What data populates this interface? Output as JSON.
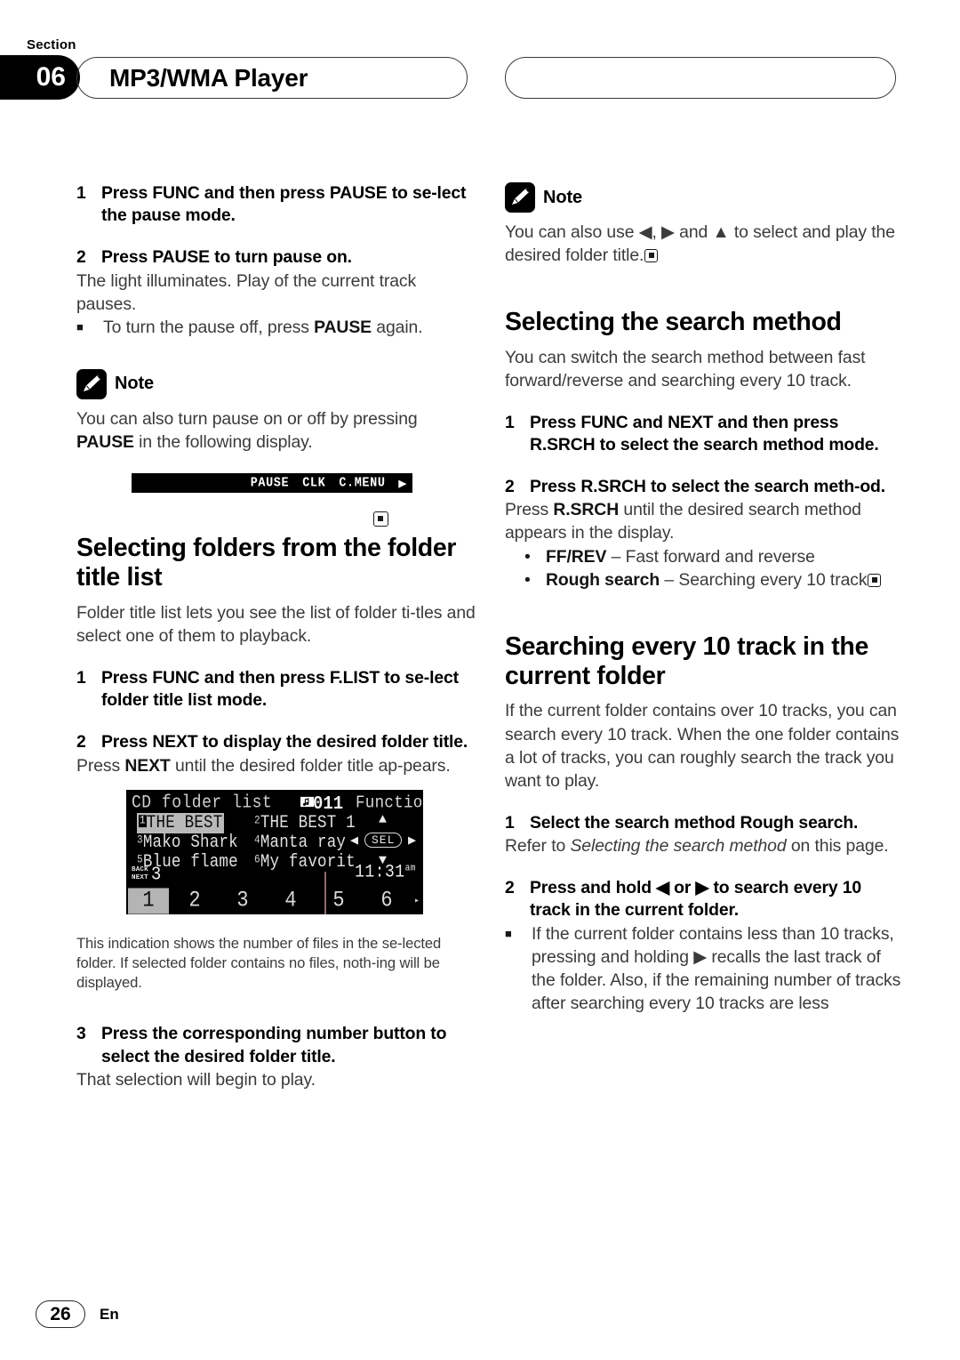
{
  "header": {
    "section_label": "Section",
    "section_number": "06",
    "title": "MP3/WMA Player"
  },
  "left_column": {
    "step1": {
      "number": "1",
      "text": "Press FUNC and then press PAUSE to se-­lect the pause mode."
    },
    "step2": {
      "number": "2",
      "text": "Press PAUSE to turn pause on."
    },
    "step2_body": "The light illuminates. Play of the current track pauses.",
    "step2_bullet_pre": "To turn the pause off, press ",
    "step2_bullet_bold": "PAUSE",
    "step2_bullet_post": " again.",
    "note": {
      "title": "Note",
      "text_pre": "You can also turn pause on or off by pressing ",
      "text_bold": "PAUSE",
      "text_post": " in the following display."
    },
    "lcd_strip": {
      "pause": "PAUSE",
      "clk": "CLK",
      "cmenu": "C.MENU",
      "arrow": "▶"
    },
    "heading": "Selecting folders from the folder title list",
    "intro": "Folder title list lets you see the list of folder ti-­tles and select one of them to playback.",
    "step_a": {
      "number": "1",
      "text": "Press FUNC and then press F.LIST to se-­lect folder title list mode."
    },
    "step_b": {
      "number": "2",
      "text": "Press NEXT to display the desired folder title."
    },
    "step_b_body_pre": "Press ",
    "step_b_body_bold": "NEXT",
    "step_b_body_post": " until the desired folder title ap-­pears.",
    "caption": "This indication shows the number of files in the se-­lected folder. If selected folder contains no files, noth-­ing will be displayed.",
    "step_c": {
      "number": "3",
      "text": "Press the corresponding number button to select the desired folder title."
    },
    "step_c_body": "That selection will begin to play."
  },
  "lcd_display": {
    "header_title": "CD folder list",
    "track_number": "011",
    "function_label": "Function",
    "items": [
      {
        "index": "1",
        "title": "THE BEST",
        "selected": true
      },
      {
        "index": "2",
        "title": "THE BEST 1",
        "selected": false
      },
      {
        "index": "3",
        "title": "Mako Shark",
        "selected": false
      },
      {
        "index": "4",
        "title": "Manta ray",
        "selected": false
      },
      {
        "index": "5",
        "title": "Blue flame",
        "selected": false
      },
      {
        "index": "6",
        "title": "My favorit",
        "selected": false
      }
    ],
    "sel_label": "SEL",
    "chevron_up": "▲",
    "chevron_down": "▼",
    "chevron_left": "◀",
    "chevron_right": "▶",
    "back_label": "BACK",
    "next_label": "NEXT",
    "file_count": "3",
    "clock_time": "11:31",
    "clock_ampm": "am",
    "number_buttons": [
      "1",
      "2",
      "3",
      "4",
      "5",
      "6"
    ],
    "number_selected": "1",
    "number_more_arrow": "▸"
  },
  "right_column": {
    "note": {
      "title": "Note",
      "text": "You can also use ◀, ▶ and ▲ to select and play the desired folder title."
    },
    "heading1": "Selecting the search method",
    "intro1": "You can switch the search method between fast forward/reverse and searching every 10 track.",
    "step1": {
      "number": "1",
      "text": "Press FUNC and NEXT and then press R.SRCH to select the search method mode."
    },
    "step2": {
      "number": "2",
      "text": "Press R.SRCH to select the search meth-­od."
    },
    "step2_body_pre": "Press ",
    "step2_body_bold": "R.SRCH",
    "step2_body_post": " until the desired search method appears in the display.",
    "bullets": [
      {
        "marker": "•",
        "bold": "FF/REV",
        "rest": " – Fast forward and reverse"
      },
      {
        "marker": "•",
        "bold": "Rough search",
        "rest": " – Searching every 10 track"
      }
    ],
    "heading2": "Searching every 10 track in the current folder",
    "intro2": "If the current folder contains over 10 tracks, you can search every 10 track. When the one folder contains a lot of tracks, you can roughly search the track you want to play.",
    "step3": {
      "number": "1",
      "text": "Select the search method Rough search."
    },
    "step3_body_pre": "Refer to ",
    "step3_body_italic": "Selecting the search method",
    "step3_body_post": " on this page.",
    "step4": {
      "number": "2",
      "text": "Press and hold ◀ or ▶ to search every 10 track in the current folder."
    },
    "final_bullet": "If the current folder contains less than 10 tracks, pressing and holding ▶ recalls the last track of the folder. Also, if the remaining number of tracks after searching every 10 tracks are less"
  },
  "footer": {
    "page_number": "26",
    "language": "En"
  }
}
